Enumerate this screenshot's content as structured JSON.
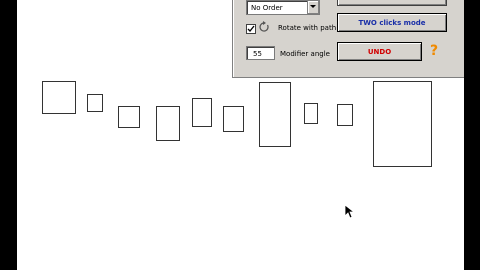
{
  "panel": {
    "order_select": {
      "value": "No Order"
    },
    "rotate_checkbox": {
      "checked": true,
      "label": "Rotate with path"
    },
    "modifier_angle": {
      "value": "55",
      "label": "Modifier angle"
    },
    "two_clicks_button": {
      "label": "TWO clicks mode"
    },
    "undo_button": {
      "label": "UNDO"
    },
    "help_icon": {
      "glyph": "?"
    }
  },
  "colors": {
    "two_clicks_text": "#1a2fa8",
    "undo_text": "#d10000",
    "help": "#f08a00"
  }
}
